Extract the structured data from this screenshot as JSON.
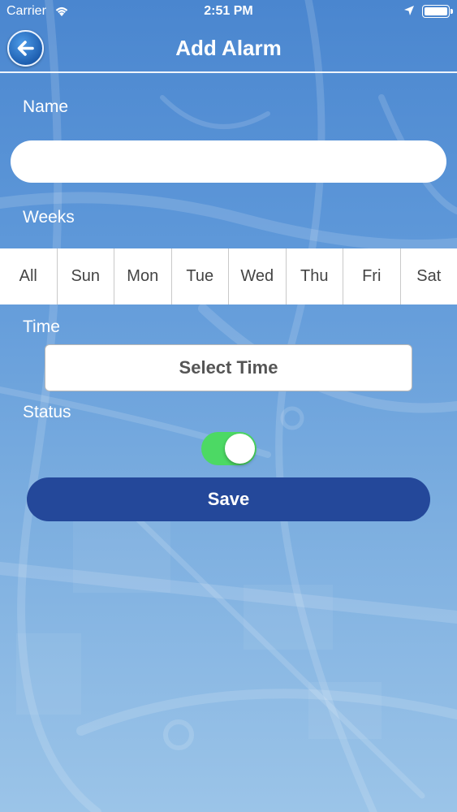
{
  "status_bar": {
    "carrier": "Carrier",
    "time": "2:51 PM",
    "icons": [
      "wifi-icon",
      "location-arrow-icon",
      "battery-icon"
    ]
  },
  "nav": {
    "title": "Add Alarm",
    "back_icon": "back-arrow-icon"
  },
  "form": {
    "name_label": "Name",
    "name_value": "",
    "name_placeholder": "",
    "weeks_label": "Weeks",
    "days": [
      "All",
      "Sun",
      "Mon",
      "Tue",
      "Wed",
      "Thu",
      "Fri",
      "Sat"
    ],
    "time_label": "Time",
    "select_time_label": "Select Time",
    "status_label": "Status",
    "status_on": true,
    "save_label": "Save"
  },
  "colors": {
    "toggle_on": "#4cd964",
    "save_button": "#24489a",
    "background_top": "#4a86cf",
    "background_bottom": "#9bc4e8"
  }
}
